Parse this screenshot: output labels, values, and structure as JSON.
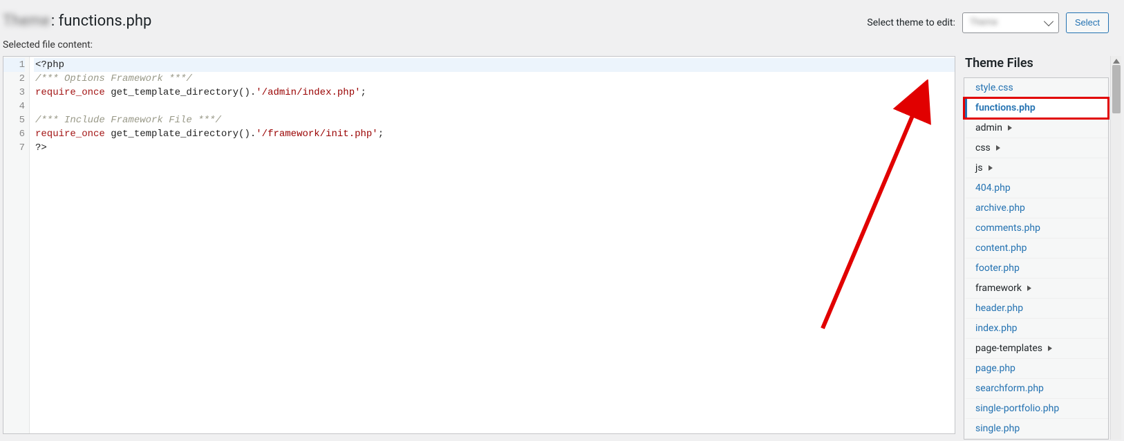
{
  "header": {
    "theme_name_obscured": "Theme",
    "title_filename": ": functions.php",
    "select_label": "Select theme to edit:",
    "select_value_obscured": "Theme",
    "select_button": "Select"
  },
  "subheader": {
    "label": "Selected file content:"
  },
  "editor": {
    "lines": [
      {
        "n": "1",
        "segments": [
          [
            "plain",
            "<?php"
          ]
        ],
        "hl": true
      },
      {
        "n": "2",
        "segments": [
          [
            "comment",
            "/*** Options Framework ***/"
          ]
        ]
      },
      {
        "n": "3",
        "segments": [
          [
            "key",
            "require_once "
          ],
          [
            "plain",
            "get_template_directory()."
          ],
          [
            "str",
            "'/admin/index.php'"
          ],
          [
            "plain",
            ";"
          ]
        ]
      },
      {
        "n": "4",
        "segments": [
          [
            "plain",
            ""
          ]
        ]
      },
      {
        "n": "5",
        "segments": [
          [
            "comment",
            "/*** Include Framework File ***/"
          ]
        ]
      },
      {
        "n": "6",
        "segments": [
          [
            "key",
            "require_once "
          ],
          [
            "plain",
            "get_template_directory()."
          ],
          [
            "str",
            "'/framework/init.php'"
          ],
          [
            "plain",
            ";"
          ]
        ]
      },
      {
        "n": "7",
        "segments": [
          [
            "plain",
            "?>"
          ]
        ]
      }
    ]
  },
  "sidebar": {
    "title": "Theme Files",
    "items": [
      {
        "type": "file",
        "label": "style.css"
      },
      {
        "type": "file",
        "label": "functions.php",
        "active": true,
        "highlight": true
      },
      {
        "type": "folder",
        "label": "admin"
      },
      {
        "type": "folder",
        "label": "css"
      },
      {
        "type": "folder",
        "label": "js"
      },
      {
        "type": "file",
        "label": "404.php"
      },
      {
        "type": "file",
        "label": "archive.php"
      },
      {
        "type": "file",
        "label": "comments.php"
      },
      {
        "type": "file",
        "label": "content.php"
      },
      {
        "type": "file",
        "label": "footer.php"
      },
      {
        "type": "folder",
        "label": "framework"
      },
      {
        "type": "file",
        "label": "header.php"
      },
      {
        "type": "file",
        "label": "index.php"
      },
      {
        "type": "folder",
        "label": "page-templates"
      },
      {
        "type": "file",
        "label": "page.php"
      },
      {
        "type": "file",
        "label": "searchform.php"
      },
      {
        "type": "file",
        "label": "single-portfolio.php"
      },
      {
        "type": "file",
        "label": "single.php"
      }
    ]
  }
}
